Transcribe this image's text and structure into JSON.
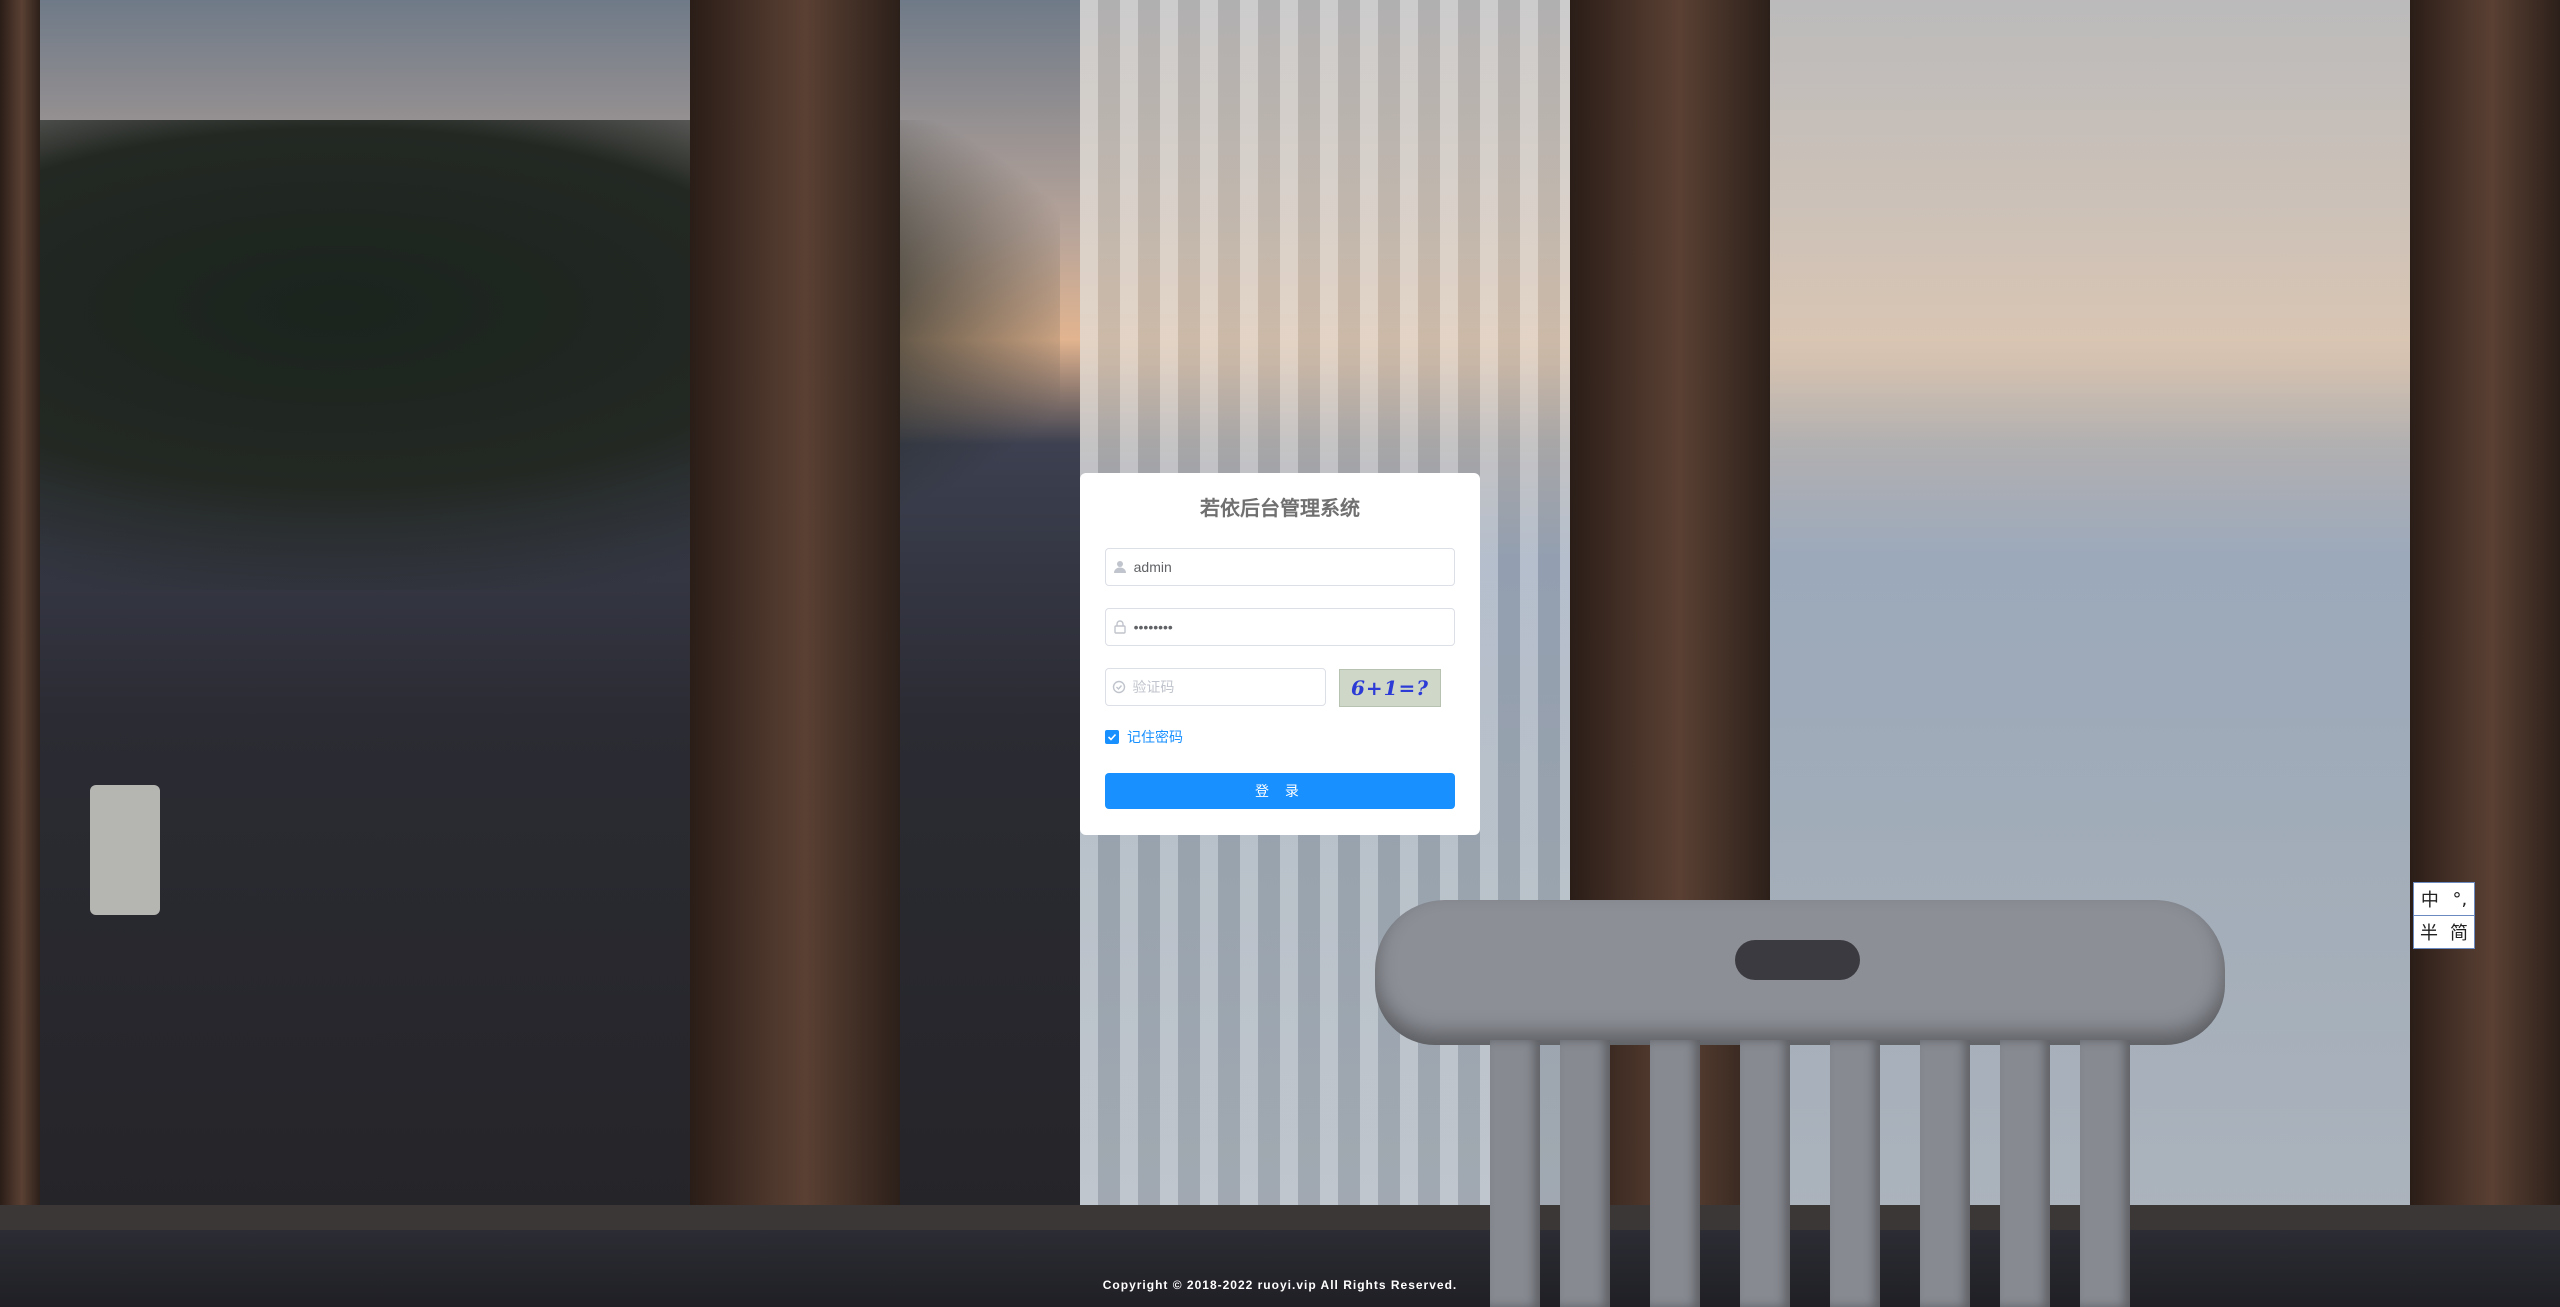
{
  "login": {
    "title": "若依后台管理系统",
    "username_value": "admin",
    "password_value": "••••••••",
    "code_placeholder": "验证码",
    "captcha_text": "6+1=?",
    "remember_label": "记住密码",
    "remember_checked": true,
    "submit_label": "登 录"
  },
  "footer": {
    "copyright": "Copyright © 2018-2022 ruoyi.vip All Rights Reserved."
  },
  "ime_toolbar": {
    "mode": "中",
    "punct": "°,",
    "width": "半",
    "script": "简"
  },
  "colors": {
    "primary": "#1890ff",
    "title": "#707070"
  }
}
